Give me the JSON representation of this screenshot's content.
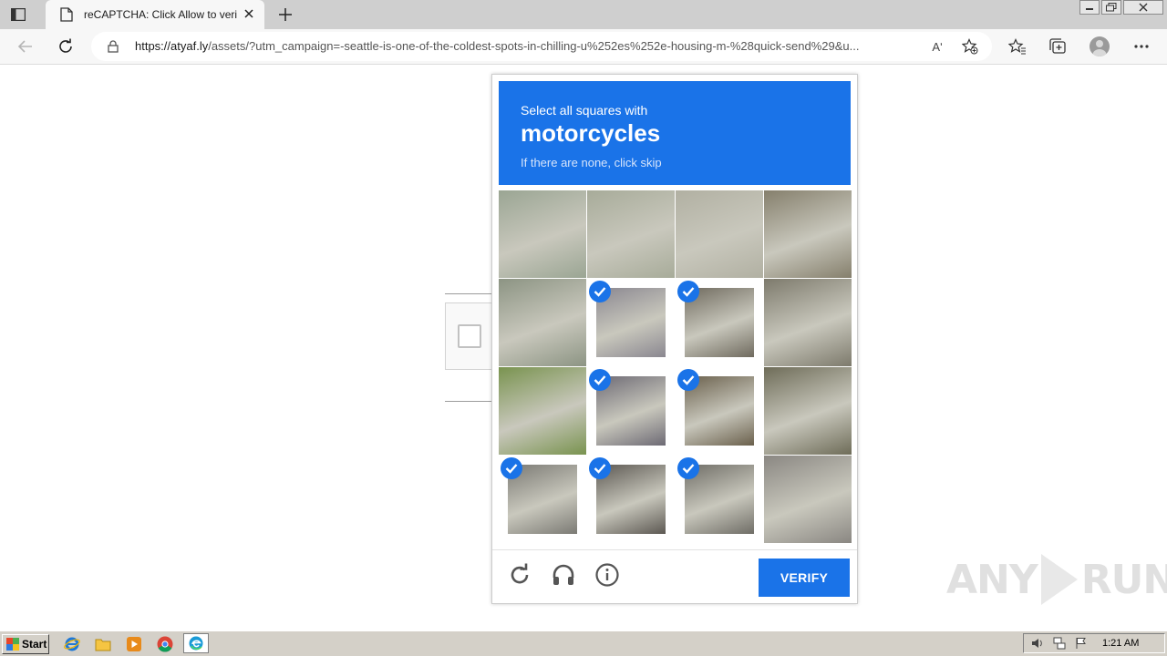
{
  "browser": {
    "tab_title": "reCAPTCHA: Click Allow to verify",
    "url_domain": "https://atyaf.ly",
    "url_path": "/assets/?utm_campaign=-seattle-is-one-of-the-coldest-spots-in-chilling-u%252es%252e-housing-m-%28quick-send%29&u...",
    "reader_label": "Aʹ"
  },
  "captcha": {
    "prompt_prefix": "Select all squares with",
    "target": "motorcycles",
    "hint": "If there are none, click skip",
    "verify_label": "VERIFY",
    "accent": "#1a73e8",
    "tiles": [
      {
        "selected": false
      },
      {
        "selected": false
      },
      {
        "selected": false
      },
      {
        "selected": false
      },
      {
        "selected": false
      },
      {
        "selected": true
      },
      {
        "selected": true
      },
      {
        "selected": false
      },
      {
        "selected": false
      },
      {
        "selected": true
      },
      {
        "selected": true
      },
      {
        "selected": false
      },
      {
        "selected": true
      },
      {
        "selected": true
      },
      {
        "selected": true
      },
      {
        "selected": false
      }
    ]
  },
  "watermark": {
    "left": "ANY",
    "right": "RUN"
  },
  "taskbar": {
    "start_label": "Start",
    "clock": "1:21 AM"
  }
}
